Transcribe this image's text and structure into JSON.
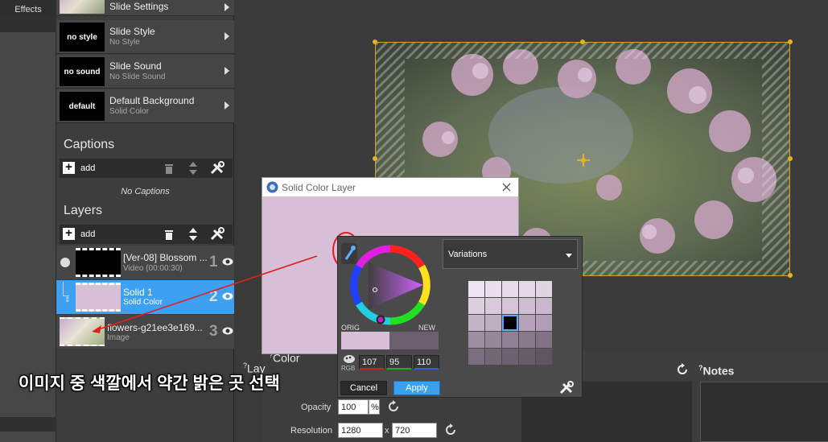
{
  "left_strip": {
    "effects_tab": "Effects"
  },
  "settings": [
    {
      "thumb": "",
      "title": "Slide Settings",
      "sub": ""
    },
    {
      "thumb": "no style",
      "title": "Slide Style",
      "sub": "No Style"
    },
    {
      "thumb": "no sound",
      "title": "Slide Sound",
      "sub": "No Slide Sound"
    },
    {
      "thumb": "default",
      "title": "Default Background",
      "sub": "Solid Color"
    }
  ],
  "captions": {
    "title": "Captions",
    "add_label": "add",
    "empty_text": "No Captions"
  },
  "layers": {
    "title": "Layers",
    "add_label": "add",
    "items": [
      {
        "title": "[Ver-08] Blossom ...",
        "sub": "Video (00:00:30)",
        "num": "1"
      },
      {
        "title": "Solid 1",
        "sub": "Solid Color",
        "num": "2"
      },
      {
        "title": "flowers-g21ee3e169...",
        "sub": "Image",
        "num": "3"
      }
    ]
  },
  "dialog": {
    "title": "Solid Color Layer",
    "color_hex": "#d8bfd8"
  },
  "picker": {
    "orig_label": "ORIG",
    "new_label": "NEW",
    "rgb_label": "RGB",
    "r": "107",
    "g": "95",
    "b": "110",
    "variations_label": "Variations",
    "cancel_label": "Cancel",
    "apply_label": "Apply",
    "orig_color": "#d8bfd8",
    "new_color": "#6b5f6e"
  },
  "properties": {
    "color_heading": "Color",
    "opacity_label": "Opacity",
    "opacity_value": "100",
    "opacity_unit": "%",
    "resolution_label": "Resolution",
    "res_w": "1280",
    "res_sep": "x",
    "res_h": "720"
  },
  "notes": {
    "title": "Notes"
  },
  "layer_heading_fragment": "Lay",
  "annotation": "이미지 중 색깔에서 약간 밝은 곳 선택"
}
